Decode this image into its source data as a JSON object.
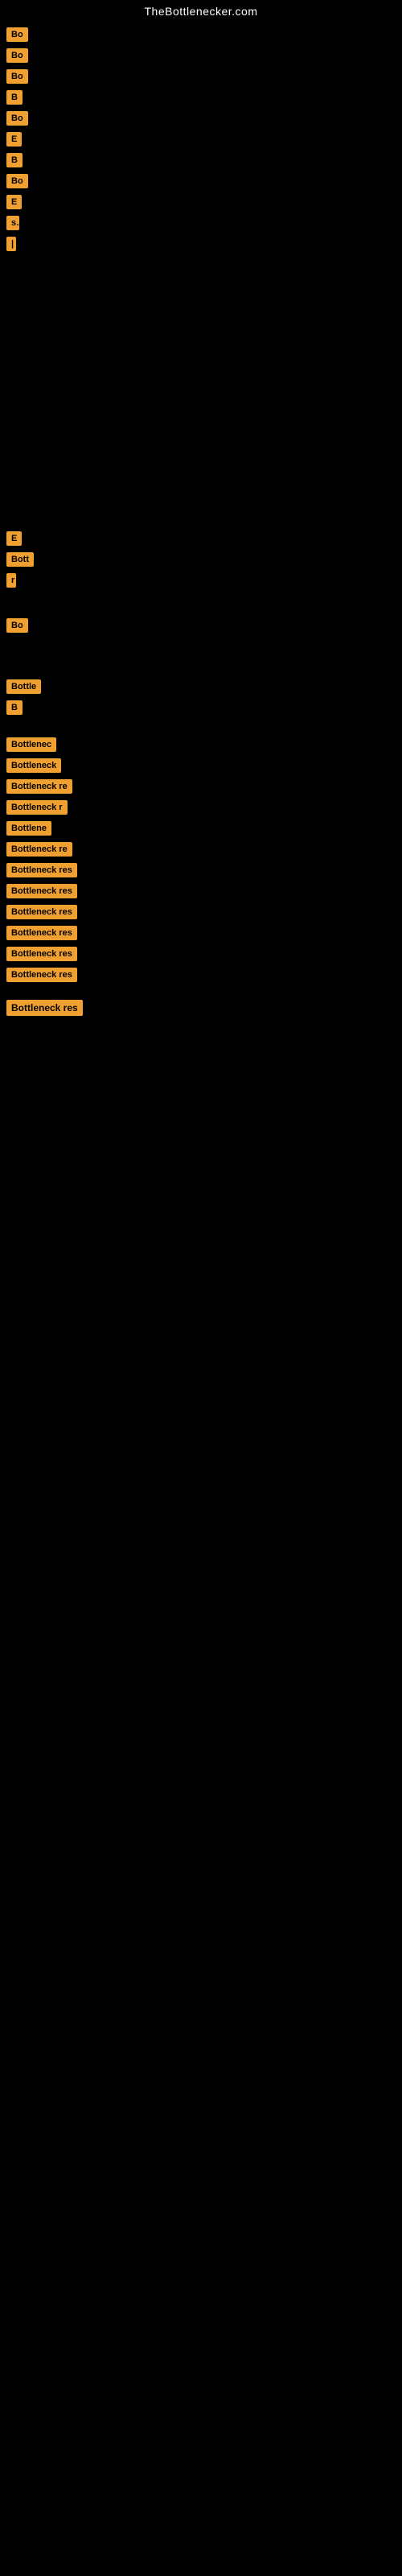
{
  "site": {
    "title": "TheBottlenecker.com"
  },
  "items": [
    {
      "id": 1,
      "btn_label": "Bo",
      "text": ""
    },
    {
      "id": 2,
      "btn_label": "Bo",
      "text": ""
    },
    {
      "id": 3,
      "btn_label": "Bo",
      "text": ""
    },
    {
      "id": 4,
      "btn_label": "B",
      "text": ""
    },
    {
      "id": 5,
      "btn_label": "Bo",
      "text": ""
    },
    {
      "id": 6,
      "btn_label": "E",
      "text": ""
    },
    {
      "id": 7,
      "btn_label": "B",
      "text": ""
    },
    {
      "id": 8,
      "btn_label": "Bo",
      "text": ""
    },
    {
      "id": 9,
      "btn_label": "E",
      "text": ""
    },
    {
      "id": 10,
      "btn_label": "s",
      "text": ""
    },
    {
      "id": 11,
      "btn_label": "|",
      "text": ""
    }
  ],
  "middle_items": [
    {
      "id": 12,
      "btn_label": "E",
      "text": ""
    },
    {
      "id": 13,
      "btn_label": "Bott",
      "text": ""
    },
    {
      "id": 14,
      "btn_label": "r",
      "text": ""
    },
    {
      "id": 15,
      "btn_label": "Bo",
      "text": ""
    }
  ],
  "lower_items": [
    {
      "id": 16,
      "btn_label": "Bottle",
      "text": ""
    },
    {
      "id": 17,
      "btn_label": "B",
      "text": ""
    }
  ],
  "bottom_items": [
    {
      "id": 18,
      "btn_label": "Bottlenec",
      "text": ""
    },
    {
      "id": 19,
      "btn_label": "Bottleneck",
      "text": ""
    },
    {
      "id": 20,
      "btn_label": "Bottleneck re",
      "text": ""
    },
    {
      "id": 21,
      "btn_label": "Bottleneck r",
      "text": ""
    },
    {
      "id": 22,
      "btn_label": "Bottlene",
      "text": ""
    },
    {
      "id": 23,
      "btn_label": "Bottleneck re",
      "text": ""
    },
    {
      "id": 24,
      "btn_label": "Bottleneck res",
      "text": ""
    },
    {
      "id": 25,
      "btn_label": "Bottleneck res",
      "text": ""
    },
    {
      "id": 26,
      "btn_label": "Bottleneck res",
      "text": ""
    },
    {
      "id": 27,
      "btn_label": "Bottleneck res",
      "text": ""
    },
    {
      "id": 28,
      "btn_label": "Bottleneck res",
      "text": ""
    },
    {
      "id": 29,
      "btn_label": "Bottleneck res",
      "text": ""
    }
  ]
}
